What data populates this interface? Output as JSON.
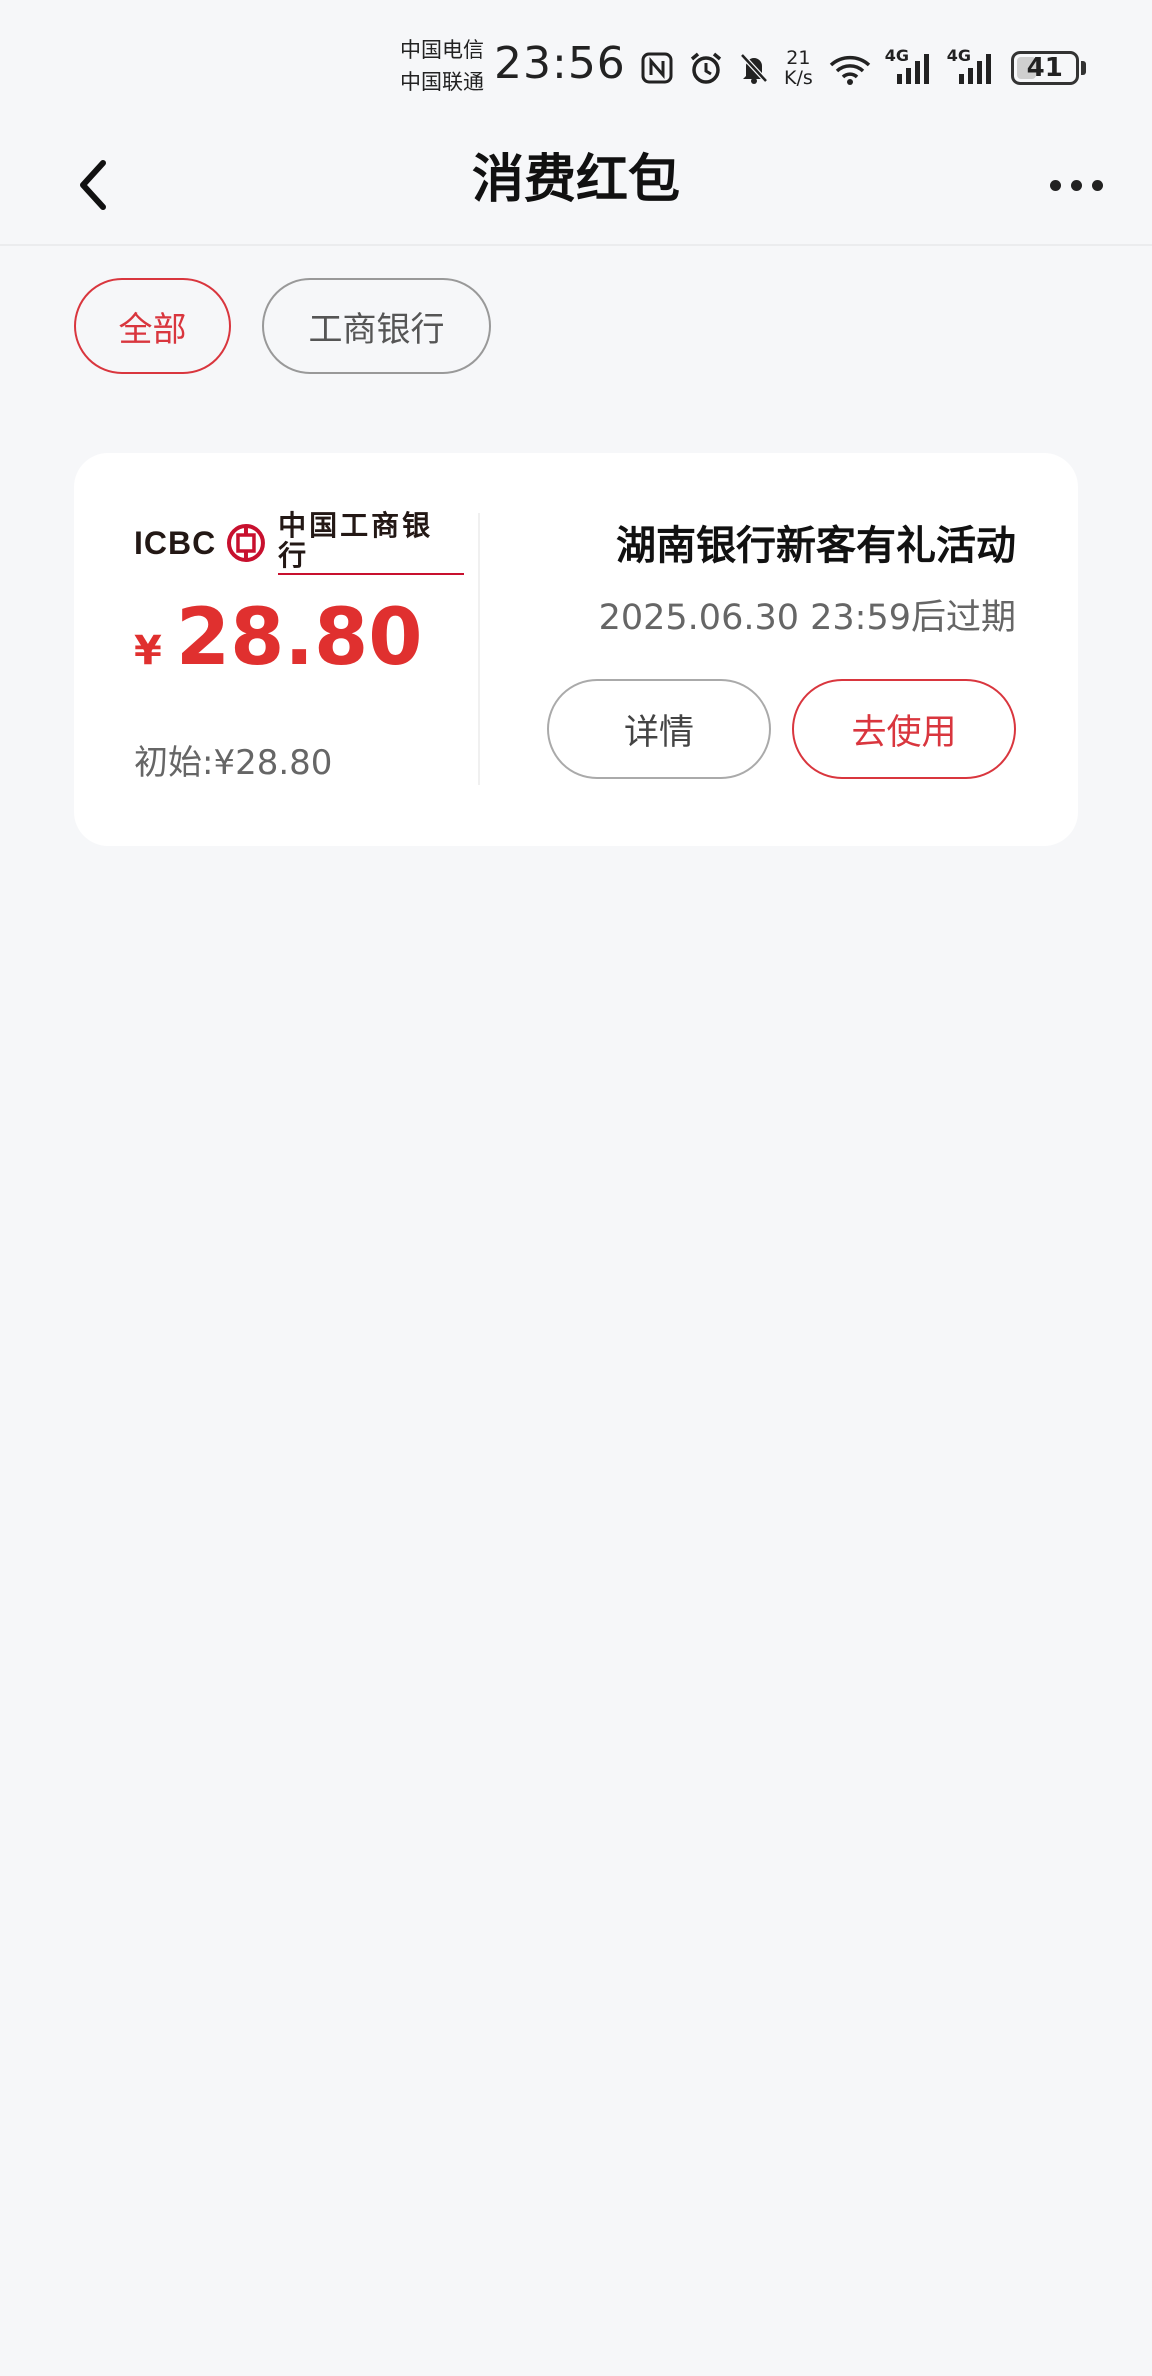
{
  "status_bar": {
    "carrier_1": "中国电信",
    "carrier_2": "中国联通",
    "time": "23:56",
    "net_speed_value": "21",
    "net_speed_unit": "K/s",
    "signal_1_label": "4G",
    "signal_2_label": "4G",
    "battery_level": "41",
    "icons": [
      "nfc-icon",
      "alarm-icon",
      "mute-bell-icon",
      "wifi-icon",
      "signal-icon",
      "battery-icon"
    ]
  },
  "nav": {
    "title": "消费红包",
    "back_icon": "chevron-left-icon",
    "more_icon": "more-horizontal-icon"
  },
  "filters": {
    "items": [
      {
        "label": "全部",
        "active": true
      },
      {
        "label": "工商银行",
        "active": false
      }
    ]
  },
  "coupon": {
    "bank_logo_text": "ICBC",
    "bank_name": "中国工商银行",
    "currency_symbol": "¥",
    "amount": "28.80",
    "initial_label": "初始:",
    "initial_amount": "¥28.80",
    "activity_name": "湖南银行新客有礼活动",
    "expiry": "2025.06.30 23:59后过期",
    "detail_button": "详情",
    "use_button": "去使用"
  },
  "colors": {
    "accent": "#d9363e",
    "amount": "#e0302f",
    "background": "#f6f7f9",
    "card": "#ffffff"
  }
}
